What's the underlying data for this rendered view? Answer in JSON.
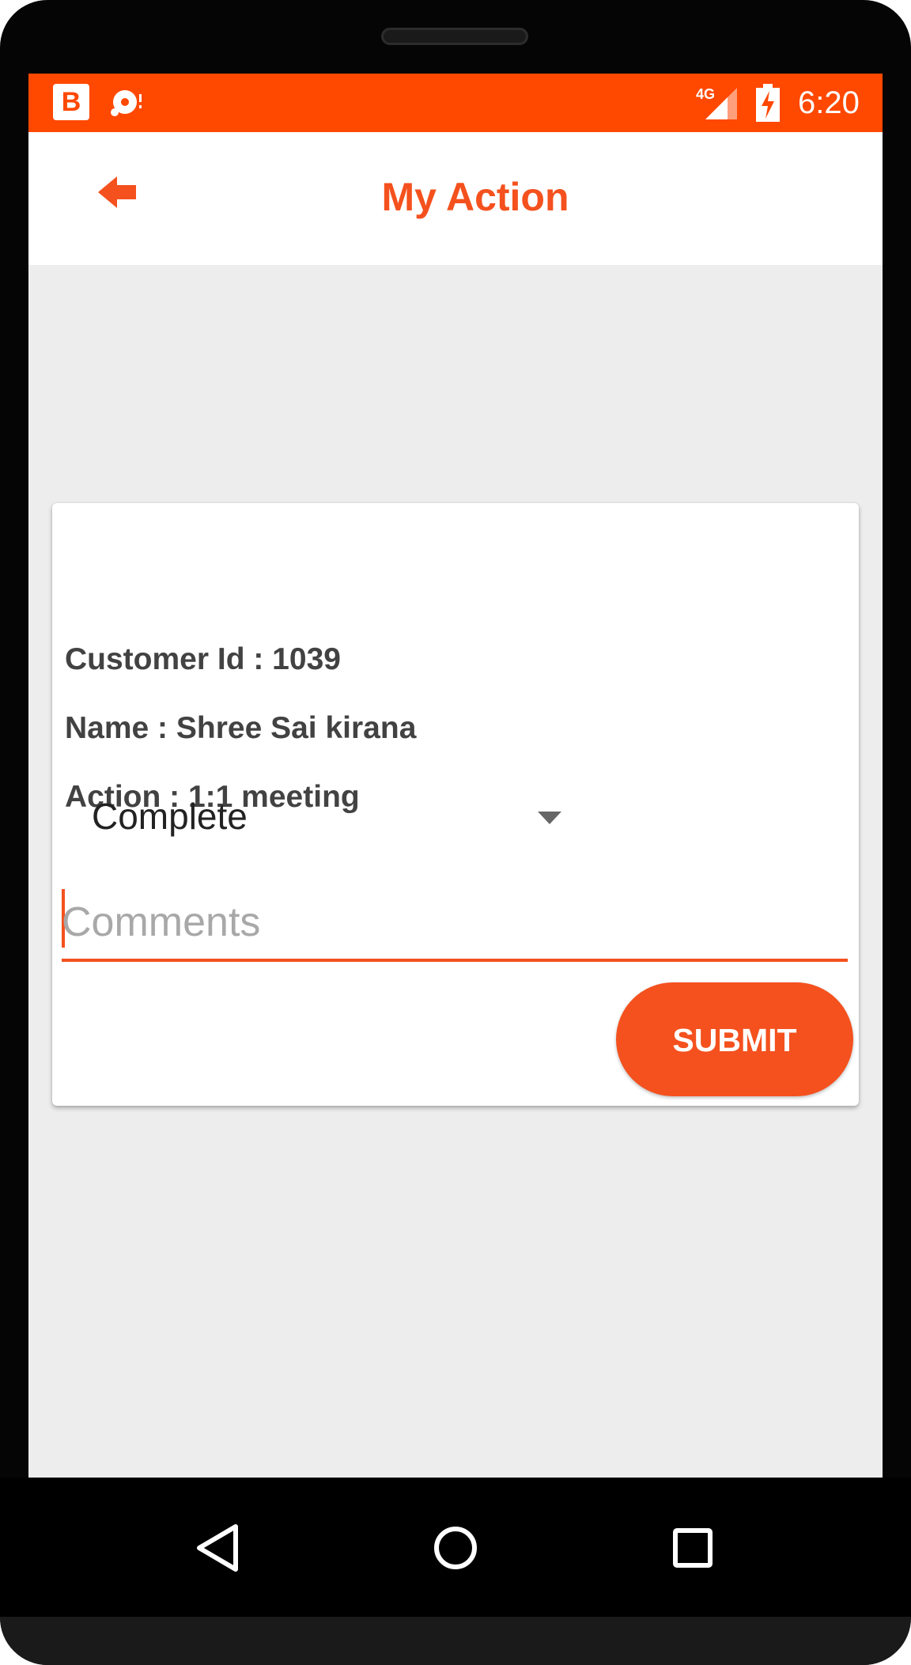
{
  "status_bar": {
    "app_badge": "B",
    "network": "4G",
    "time": "6:20",
    "background_color": "#ff4800"
  },
  "app_bar": {
    "title": "My Action",
    "back_icon": "arrow-left-icon",
    "accent_color": "#f4511e"
  },
  "card": {
    "customer_id": "Customer Id : 1039",
    "name": "Name : Shree Sai kirana",
    "action": "Action : 1:1 meeting",
    "status_select": {
      "selected": "Complete"
    },
    "comments": {
      "value": "",
      "placeholder": "Comments"
    },
    "submit_label": "SUBMIT"
  },
  "nav_bar": {
    "back": "nav-back-icon",
    "home": "nav-home-icon",
    "recents": "nav-recents-icon"
  }
}
